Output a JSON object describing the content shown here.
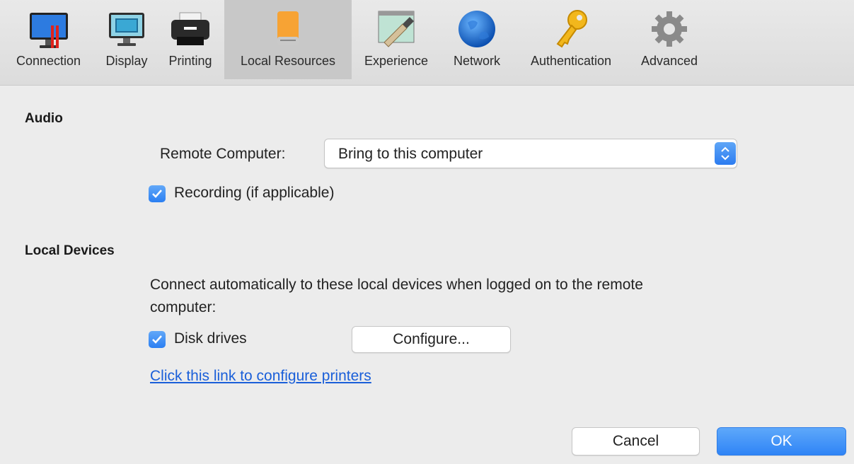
{
  "toolbar": {
    "tabs": [
      {
        "label": "Connection",
        "icon": "monitor-red-icon"
      },
      {
        "label": "Display",
        "icon": "display-icon"
      },
      {
        "label": "Printing",
        "icon": "printer-icon"
      },
      {
        "label": "Local Resources",
        "icon": "hard-drive-icon",
        "active": true
      },
      {
        "label": "Experience",
        "icon": "paintbrush-icon"
      },
      {
        "label": "Network",
        "icon": "globe-icon"
      },
      {
        "label": "Authentication",
        "icon": "key-icon"
      },
      {
        "label": "Advanced",
        "icon": "gear-icon"
      }
    ]
  },
  "audio": {
    "title": "Audio",
    "remote_label": "Remote Computer:",
    "remote_value": "Bring to this computer",
    "recording_label": "Recording (if applicable)",
    "recording_checked": true
  },
  "devices": {
    "title": "Local Devices",
    "description_line1": "Connect automatically to these local devices when logged on to the remote",
    "description_line2": "computer:",
    "disk_label": "Disk drives",
    "disk_checked": true,
    "configure_label": "Configure...",
    "printers_link": "Click this link to configure printers"
  },
  "footer": {
    "cancel_label": "Cancel",
    "ok_label": "OK"
  },
  "colors": {
    "accent": "#2f84f6",
    "link": "#1a5fd9"
  }
}
